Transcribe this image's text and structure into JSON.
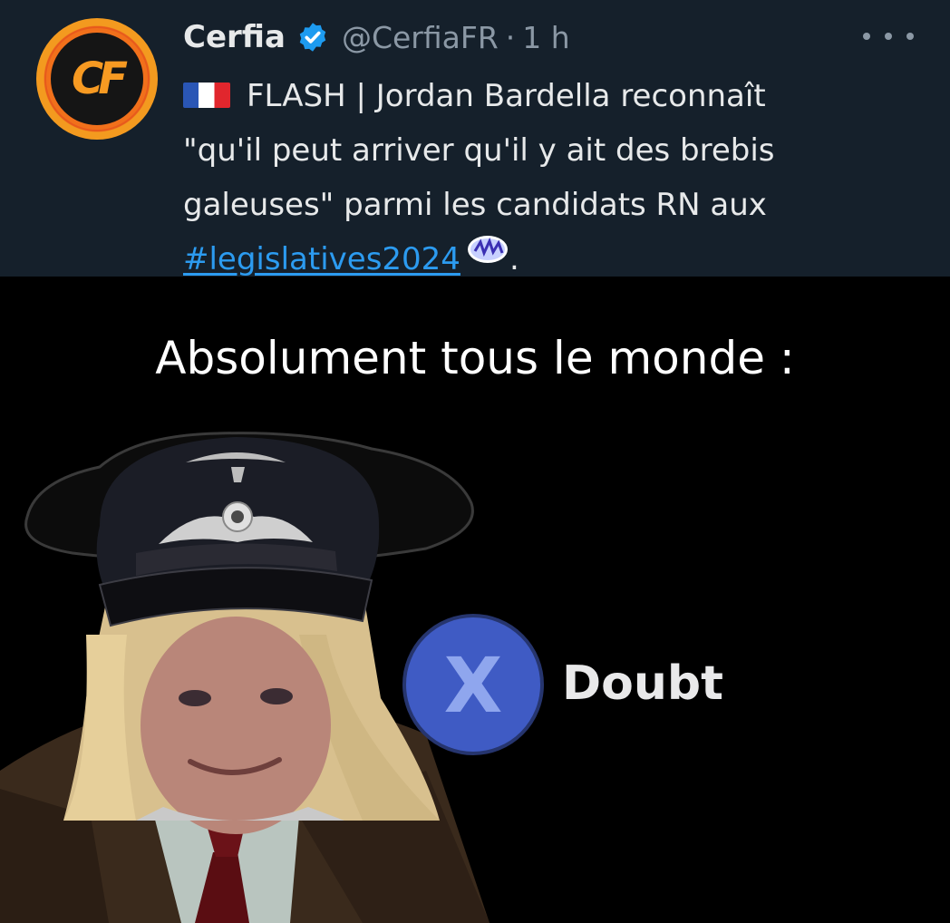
{
  "tweet": {
    "author_name": "Cerfia",
    "handle": "@CerfiaFR",
    "separator": "·",
    "time": "1 h",
    "avatar_initials": "CF",
    "lines": [
      "FLASH | Jordan Bardella reconnaît",
      "\"qu'il peut arriver qu'il y ait des brebis",
      "galeuses\" parmi les candidats RN aux"
    ],
    "hashtag": "#legislatives2024",
    "end_punctuation": ".",
    "colors": {
      "background": "#15202b",
      "text": "#e7e9ea",
      "muted": "#8b98a5",
      "link": "#2c9bf0",
      "verified": "#1d9bf0"
    }
  },
  "caption": "Absolument tous le monde :",
  "meme": {
    "button_glyph": "X",
    "doubt_label": "Doubt",
    "button_color": "#3f5bc4"
  }
}
